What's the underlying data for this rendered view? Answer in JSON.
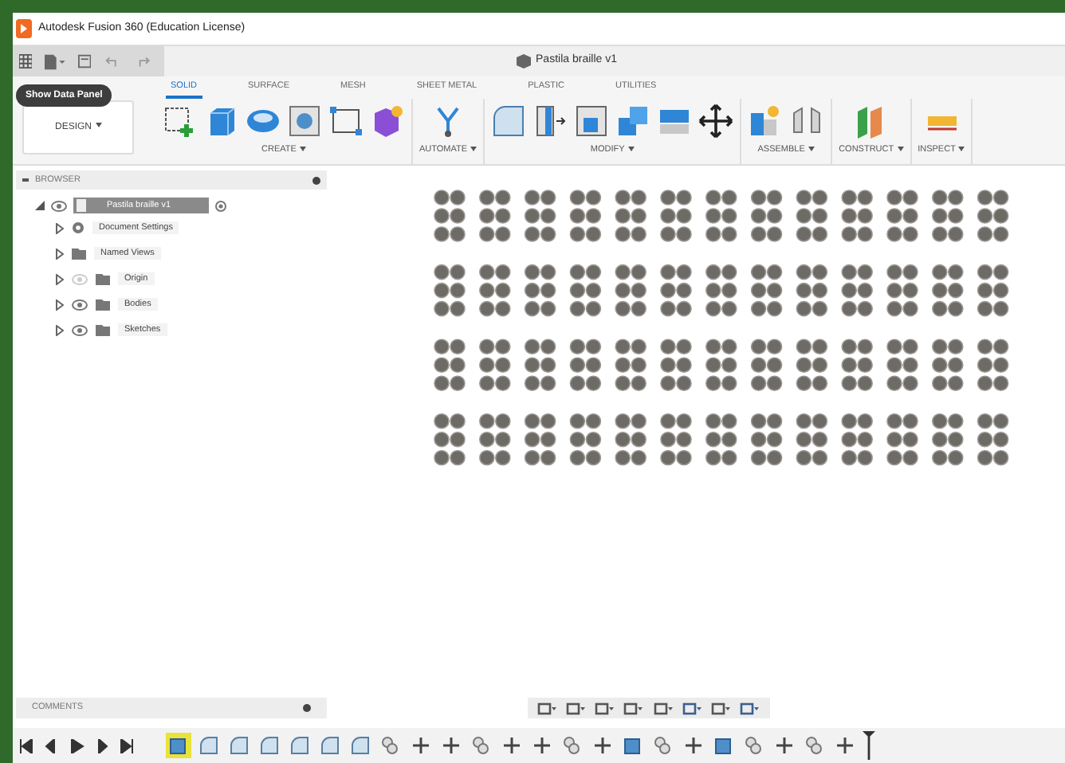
{
  "window": {
    "title": "Autodesk Fusion 360 (Education License)"
  },
  "document_title": "Pastila braille v1",
  "tooltip": "Show Data Panel",
  "workspace": "DESIGN",
  "tabs": [
    {
      "label": "SOLID",
      "selected": true
    },
    {
      "label": "SURFACE",
      "selected": false
    },
    {
      "label": "MESH",
      "selected": false
    },
    {
      "label": "SHEET METAL",
      "selected": false
    },
    {
      "label": "PLASTIC",
      "selected": false
    },
    {
      "label": "UTILITIES",
      "selected": false
    }
  ],
  "ribbon_groups": [
    {
      "label": "CREATE",
      "tools": [
        {
          "kind": "sketch"
        },
        {
          "kind": "box"
        },
        {
          "kind": "pipe"
        },
        {
          "kind": "hole"
        },
        {
          "kind": "rectangle"
        },
        {
          "kind": "plugin"
        }
      ]
    },
    {
      "label": "AUTOMATE",
      "tools": [
        {
          "kind": "fork"
        }
      ]
    },
    {
      "label": "MODIFY",
      "tools": [
        {
          "kind": "pressPull"
        },
        {
          "kind": "fillet"
        },
        {
          "kind": "shell"
        },
        {
          "kind": "combine"
        },
        {
          "kind": "offset"
        },
        {
          "kind": "move"
        }
      ]
    },
    {
      "label": "ASSEMBLE",
      "tools": [
        {
          "kind": "component"
        },
        {
          "kind": "joint"
        }
      ]
    },
    {
      "label": "CONSTRUCT",
      "tools": [
        {
          "kind": "plane"
        }
      ]
    },
    {
      "label": "INSPECT",
      "tools": [
        {
          "kind": "measure"
        }
      ]
    }
  ],
  "browser": {
    "title": "BROWSER",
    "root": {
      "label": "Pastila braille v1",
      "children": [
        {
          "label": "Document Settings",
          "kind": "settings"
        },
        {
          "label": "Named Views",
          "kind": "folder"
        },
        {
          "label": "Origin",
          "kind": "folder",
          "visible": false
        },
        {
          "label": "Bodies",
          "kind": "folder",
          "visible": true
        },
        {
          "label": "Sketches",
          "kind": "folder",
          "visible": true
        }
      ]
    }
  },
  "comments": {
    "title": "COMMENTS"
  },
  "timeline": [
    {
      "kind": "sketch",
      "selected": true
    },
    {
      "kind": "extrude",
      "selected": false
    },
    {
      "kind": "extrude",
      "selected": false
    },
    {
      "kind": "extrude",
      "selected": false
    },
    {
      "kind": "extrude",
      "selected": false
    },
    {
      "kind": "extrude",
      "selected": false
    },
    {
      "kind": "extrude",
      "selected": false
    },
    {
      "kind": "combine",
      "selected": false
    },
    {
      "kind": "move",
      "selected": false
    },
    {
      "kind": "move",
      "selected": false
    },
    {
      "kind": "combine",
      "selected": false
    },
    {
      "kind": "move",
      "selected": false
    },
    {
      "kind": "move",
      "selected": false
    },
    {
      "kind": "combine",
      "selected": false
    },
    {
      "kind": "move",
      "selected": false
    },
    {
      "kind": "sketch",
      "selected": false
    },
    {
      "kind": "combine",
      "selected": false
    },
    {
      "kind": "move",
      "selected": false
    },
    {
      "kind": "sketch",
      "selected": false
    },
    {
      "kind": "combine",
      "selected": false
    },
    {
      "kind": "move",
      "selected": false
    },
    {
      "kind": "combine",
      "selected": false
    },
    {
      "kind": "move",
      "selected": false
    }
  ]
}
